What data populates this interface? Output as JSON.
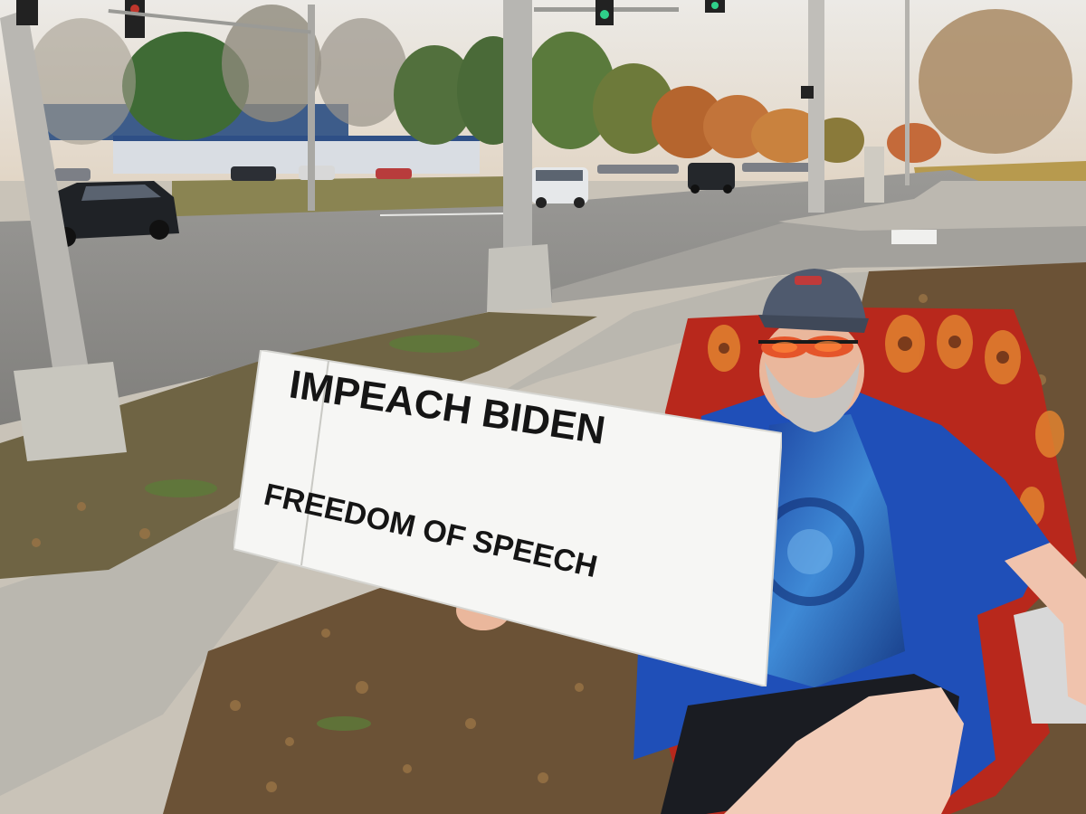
{
  "sign": {
    "line1": "IMPEACH BIDEN",
    "line2": "FREEDOM OF SPEECH"
  },
  "colors": {
    "sky": "#e9e4dc",
    "road": "#8f8e8c",
    "sidewalk": "#b9b6ae",
    "grass_leaves": "#6e5a3c",
    "shirt": "#1f4fb8",
    "chair": "#b8281c",
    "cap": "#4f5a6e",
    "sign": "#f6f6f4"
  }
}
